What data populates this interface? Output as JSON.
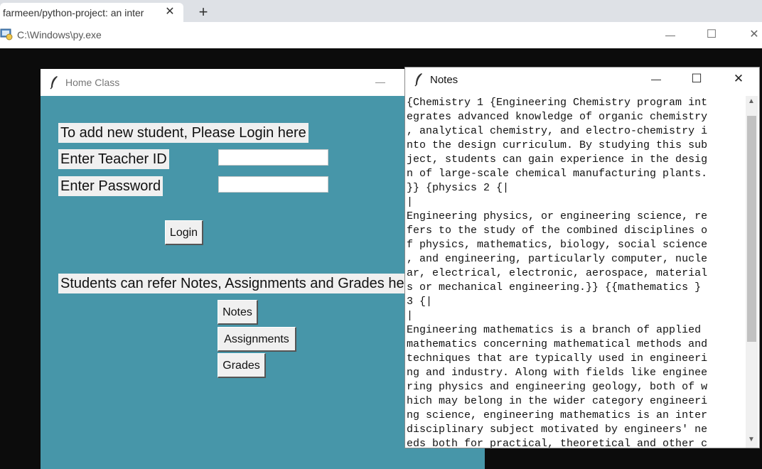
{
  "browser": {
    "tab_title": "farmeen/python-project: an inter",
    "tab_close": "✕",
    "new_tab": "+"
  },
  "console": {
    "title": "C:\\Windows\\py.exe",
    "minimize": "—",
    "maximize": "☐",
    "close": "✕"
  },
  "home": {
    "title": "Home Class",
    "minimize": "—",
    "prompt": "To add new student, Please Login here",
    "teacher_id_label": "Enter Teacher ID",
    "teacher_id_value": "",
    "password_label": "Enter Password",
    "password_value": "",
    "login_label": "Login",
    "students_label": "Students can refer Notes, Assignments and Grades here",
    "notes_label": "Notes",
    "assignments_label": "Assignments",
    "grades_label": "Grades"
  },
  "notes": {
    "title": "Notes",
    "minimize": "—",
    "maximize": "☐",
    "close": "✕",
    "content": "{Chemistry 1 {Engineering Chemistry program int\negrates advanced knowledge of organic chemistry\n, analytical chemistry, and electro-chemistry i\nnto the design curriculum. By studying this sub\nject, students can gain experience in the desig\nn of large-scale chemical manufacturing plants.\n}} {physics 2 {|\n|\nEngineering physics, or engineering science, re\nfers to the study of the combined disciplines o\nf physics, mathematics, biology, social science\n, and engineering, particularly computer, nucle\nar, electrical, electronic, aerospace, material\ns or mechanical engineering.}} {{mathematics }\n3 {|\n|\nEngineering mathematics is a branch of applied\nmathematics concerning mathematical methods and\ntechniques that are typically used in engineeri\nng and industry. Along with fields like enginee\nring physics and engineering geology, both of w\nhich may belong in the wider category engineeri\nng science, engineering mathematics is an inter\ndisciplinary subject motivated by engineers' ne\neds both for practical, theoretical and other c",
    "scroll_up": "▲",
    "scroll_down": "▼"
  },
  "colors": {
    "home_background": "#4796a9",
    "console_background": "#0c0c0c",
    "tab_strip": "#dee1e6"
  },
  "icons": [
    "python-console-icon",
    "tk-feather-icon"
  ]
}
